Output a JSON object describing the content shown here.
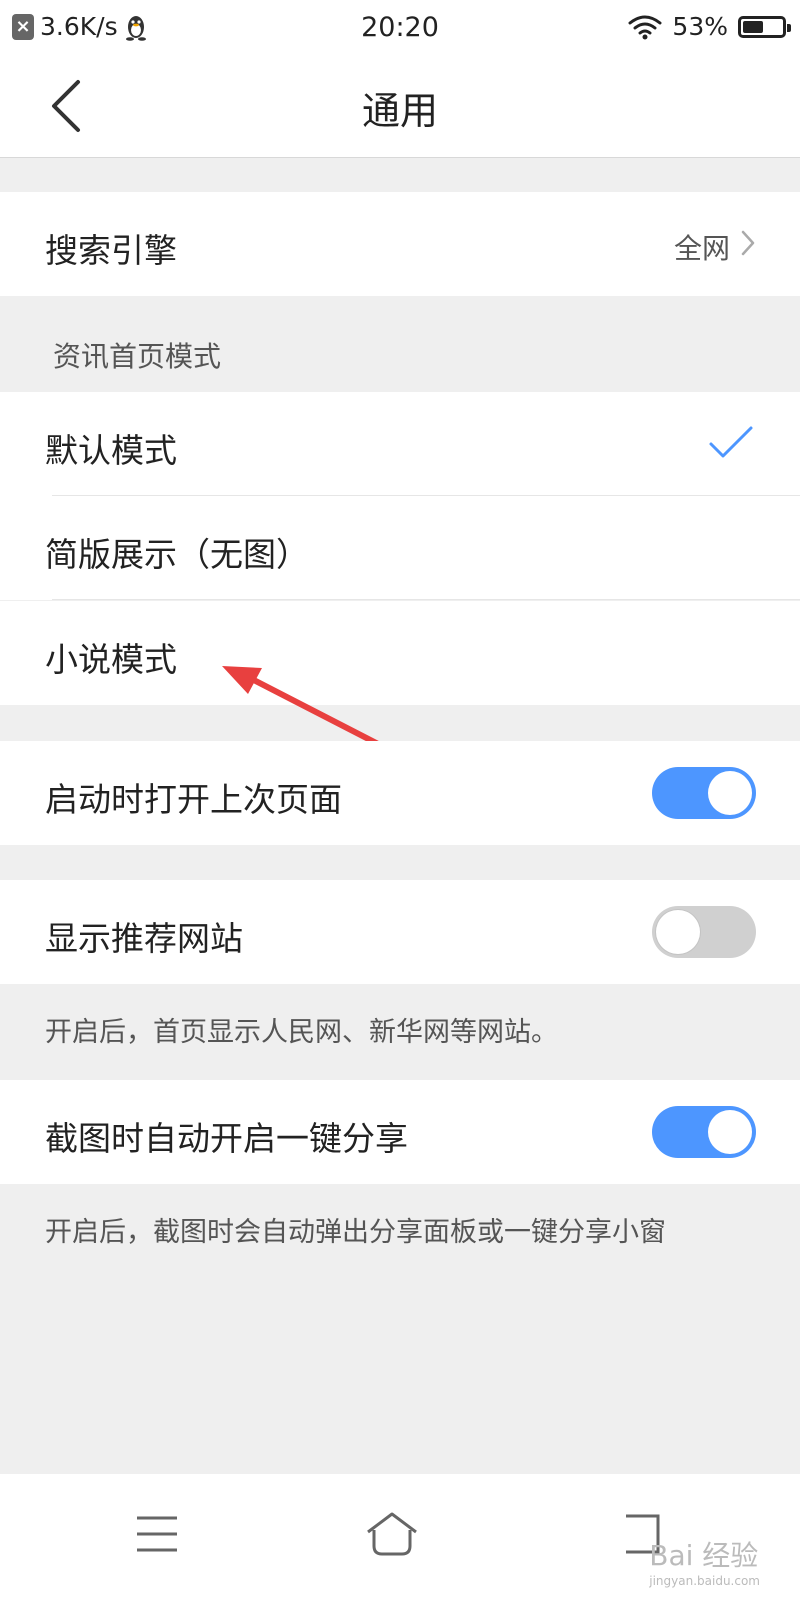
{
  "status_bar": {
    "net_speed": "3.6K/s",
    "time": "20:20",
    "battery_percent": "53%",
    "battery_level": 0.53
  },
  "header": {
    "title": "通用"
  },
  "settings": {
    "search_engine": {
      "label": "搜索引擎",
      "value": "全网"
    },
    "news_home_mode": {
      "section_label": "资讯首页模式",
      "options": [
        {
          "label": "默认模式",
          "selected": true
        },
        {
          "label": "简版展示（无图）",
          "selected": false
        },
        {
          "label": "小说模式",
          "selected": false
        }
      ]
    },
    "open_last_page": {
      "label": "启动时打开上次页面",
      "enabled": true
    },
    "show_recommended_sites": {
      "label": "显示推荐网站",
      "enabled": false,
      "hint": "开启后，首页显示人民网、新华网等网站。"
    },
    "screenshot_share": {
      "label": "截图时自动开启一键分享",
      "enabled": true,
      "hint": "开启后，截图时会自动弹出分享面板或一键分享小窗"
    }
  },
  "watermark": {
    "text": "Bai 经验",
    "sub": "jingyan.baidu.com"
  },
  "colors": {
    "accent": "#4d96ff",
    "annotation_arrow": "#e8403f"
  }
}
